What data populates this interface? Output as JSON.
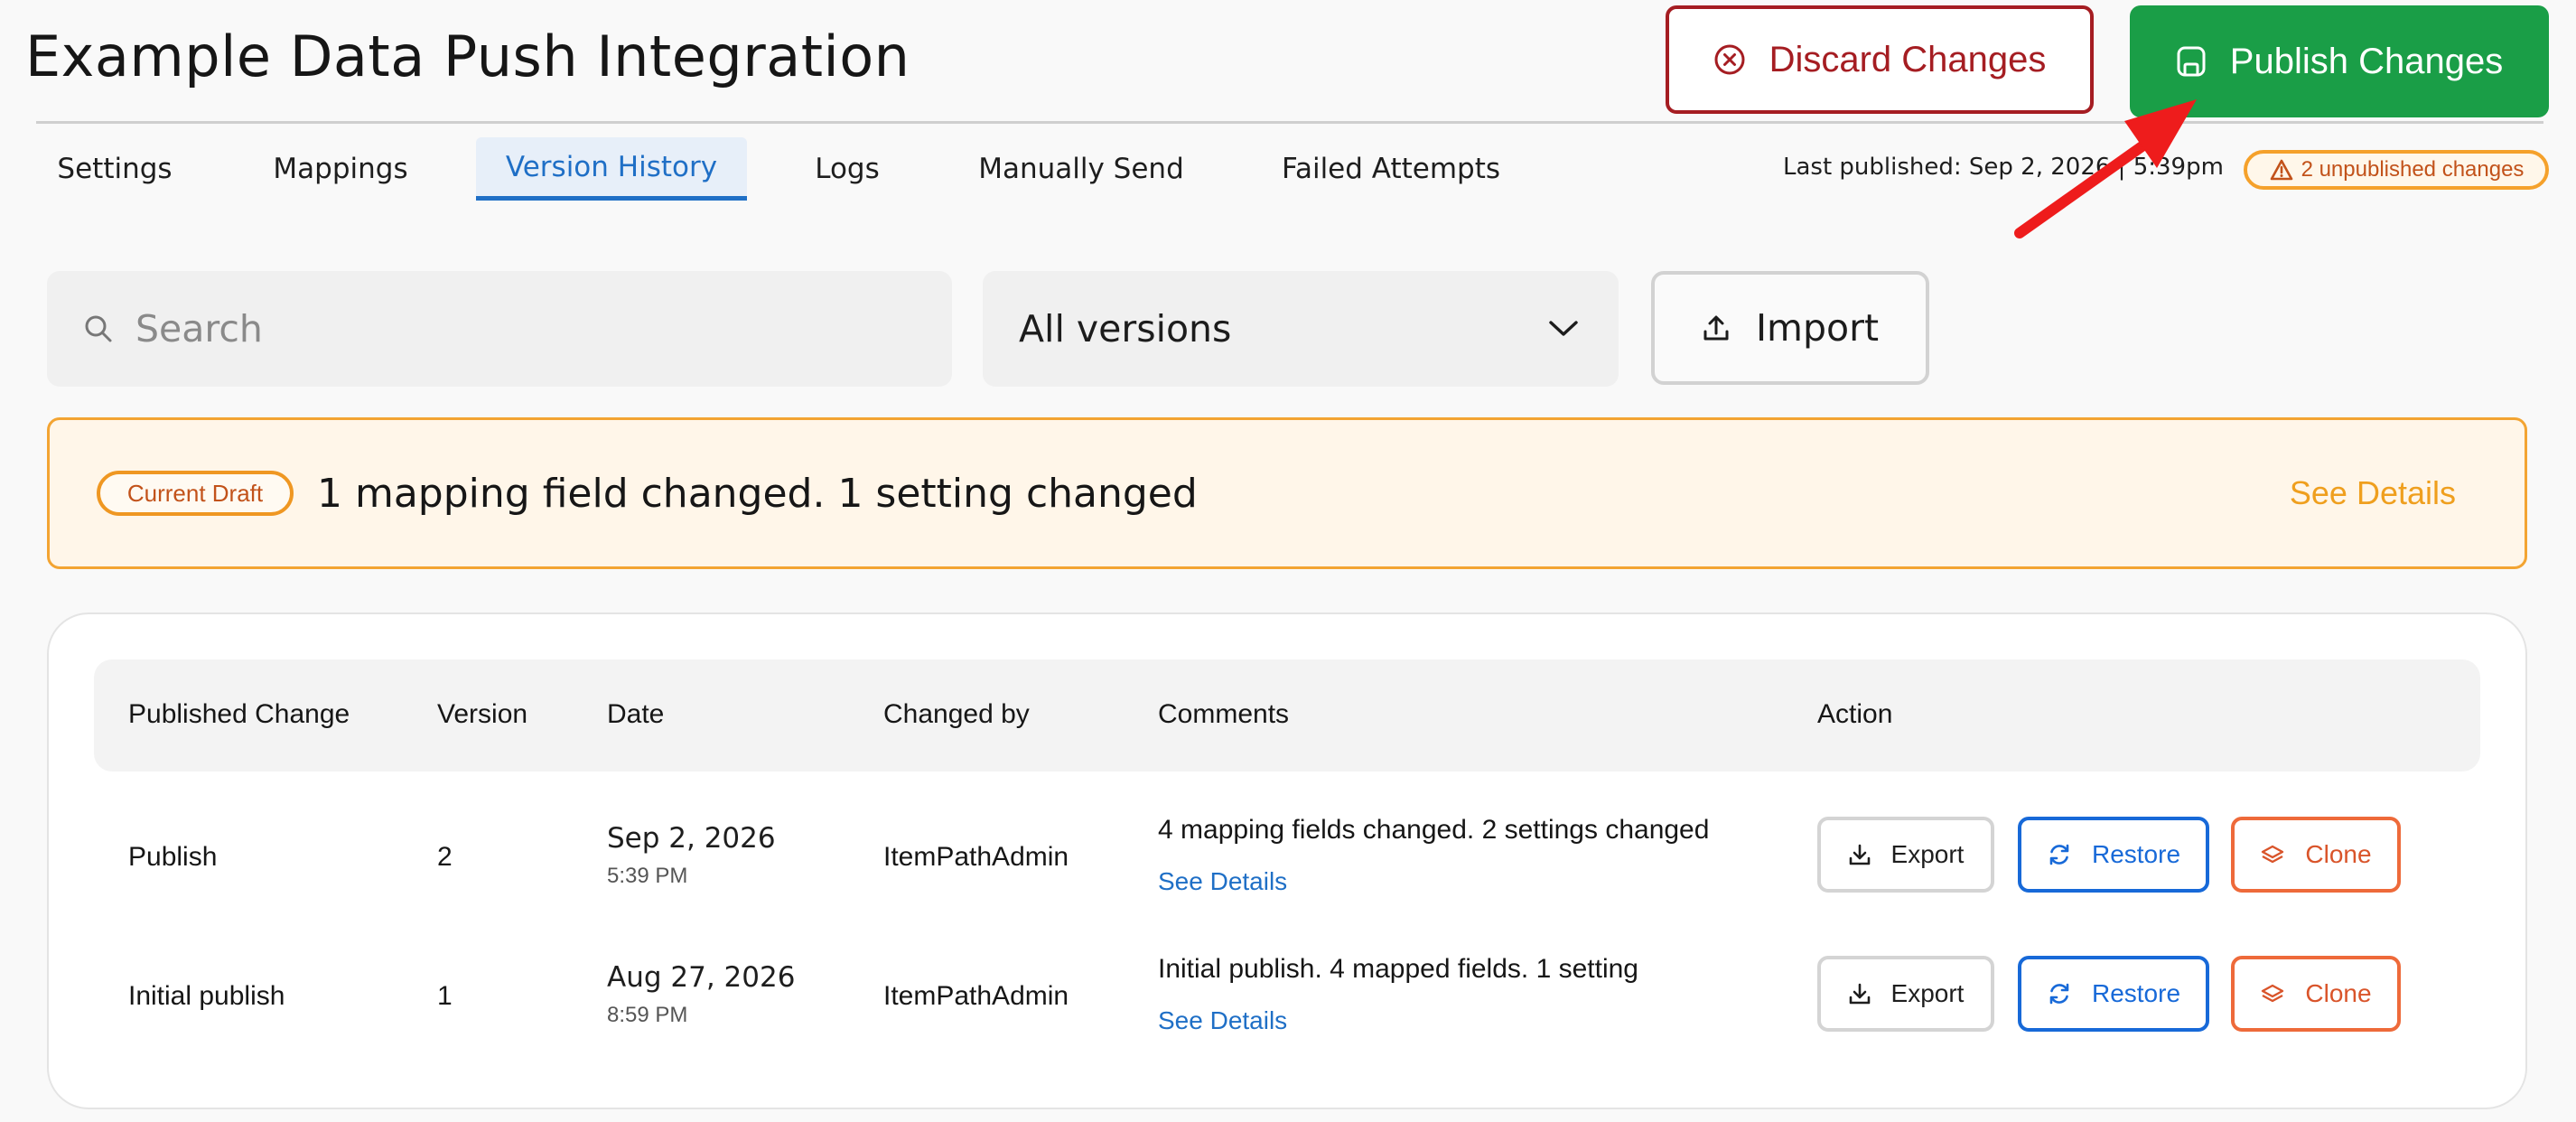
{
  "header": {
    "title": "Example Data Push Integration",
    "discard_label": "Discard Changes",
    "publish_label": "Publish Changes"
  },
  "tabs": [
    {
      "label": "Settings"
    },
    {
      "label": "Mappings"
    },
    {
      "label": "Version History",
      "active": true
    },
    {
      "label": "Logs"
    },
    {
      "label": "Manually Send"
    },
    {
      "label": "Failed Attempts"
    }
  ],
  "status": {
    "last_published": "Last published: Sep 2, 2026 | 5:39pm",
    "unpublished_badge": "2 unpublished changes"
  },
  "toolbar": {
    "search_placeholder": "Search",
    "version_filter": "All versions",
    "import_label": "Import"
  },
  "draft": {
    "badge": "Current Draft",
    "summary": "1 mapping field changed. 1 setting changed",
    "see_details": "See Details"
  },
  "table": {
    "headers": [
      "Published Change",
      "Version",
      "Date",
      "Changed by",
      "Comments",
      "Action"
    ],
    "rows": [
      {
        "change": "Publish",
        "version": "2",
        "date": "Sep 2, 2026",
        "time": "5:39 PM",
        "changed_by": "ItemPathAdmin",
        "comment": "4 mapping fields changed. 2 settings changed",
        "see_details": "See Details"
      },
      {
        "change": "Initial publish",
        "version": "1",
        "date": "Aug 27, 2026",
        "time": "8:59 PM",
        "changed_by": "ItemPathAdmin",
        "comment": "Initial publish. 4 mapped fields. 1 setting",
        "see_details": "See Details"
      }
    ],
    "actions": {
      "export": "Export",
      "restore": "Restore",
      "clone": "Clone"
    }
  },
  "colors": {
    "publish_green": "#1a9e47",
    "discard_red": "#a51d22",
    "active_tab_blue": "#1f6fc6",
    "draft_orange": "#f3a432",
    "annotation_arrow": "#ee1c1c"
  },
  "icons": {
    "discard": "x-circle-icon",
    "publish": "save-icon",
    "unpublished": "warning-triangle-icon",
    "search": "search-icon",
    "select": "chevron-down-icon",
    "import": "upload-icon",
    "export": "download-icon",
    "restore": "refresh-icon",
    "clone": "layers-icon",
    "annotation": "red-arrow-icon"
  }
}
